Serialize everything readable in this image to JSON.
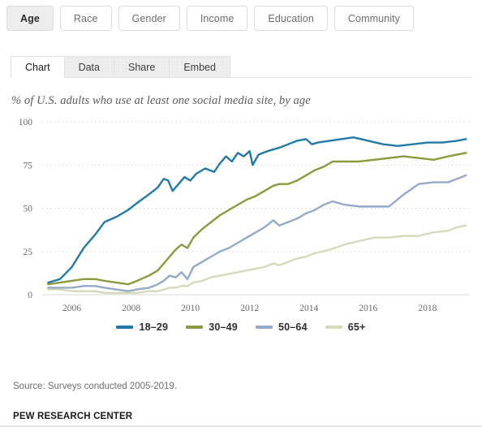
{
  "filters": {
    "items": [
      {
        "label": "Age",
        "active": true
      },
      {
        "label": "Race",
        "active": false
      },
      {
        "label": "Gender",
        "active": false
      },
      {
        "label": "Income",
        "active": false
      },
      {
        "label": "Education",
        "active": false
      },
      {
        "label": "Community",
        "active": false
      }
    ]
  },
  "tabs": {
    "items": [
      {
        "label": "Chart",
        "active": true
      },
      {
        "label": "Data",
        "active": false
      },
      {
        "label": "Share",
        "active": false
      },
      {
        "label": "Embed",
        "active": false
      }
    ]
  },
  "footer": {
    "source": "Source: Surveys conducted 2005-2019.",
    "organization": "PEW RESEARCH CENTER"
  },
  "chart_data": {
    "type": "line",
    "title": "% of U.S. adults who use at least one social media site, by age",
    "xlabel": "",
    "ylabel": "",
    "ylim": [
      0,
      100
    ],
    "xlim": [
      2005.0,
      2019.4
    ],
    "yticks": [
      0,
      25,
      50,
      75,
      100
    ],
    "xticks": [
      2006,
      2008,
      2010,
      2012,
      2014,
      2016,
      2018
    ],
    "grid": "horizontal-dotted",
    "legend_position": "bottom-center",
    "colors": {
      "18-29": "#1f7aa8",
      "30-49": "#8a9a3c",
      "50-64": "#95a9c9",
      "65+": "#d7d8bc"
    },
    "series": [
      {
        "name": "18-29",
        "color": "#1f7aa8",
        "points": [
          [
            2005.2,
            7
          ],
          [
            2005.6,
            9
          ],
          [
            2006.0,
            16
          ],
          [
            2006.4,
            27
          ],
          [
            2006.8,
            35
          ],
          [
            2007.1,
            42
          ],
          [
            2007.5,
            45
          ],
          [
            2007.9,
            49
          ],
          [
            2008.2,
            53
          ],
          [
            2008.6,
            58
          ],
          [
            2008.9,
            62
          ],
          [
            2009.1,
            67
          ],
          [
            2009.25,
            66
          ],
          [
            2009.4,
            60
          ],
          [
            2009.6,
            64
          ],
          [
            2009.8,
            68
          ],
          [
            2010.0,
            66
          ],
          [
            2010.2,
            70
          ],
          [
            2010.5,
            73
          ],
          [
            2010.8,
            71
          ],
          [
            2011.0,
            76
          ],
          [
            2011.2,
            80
          ],
          [
            2011.4,
            77
          ],
          [
            2011.6,
            82
          ],
          [
            2011.8,
            80
          ],
          [
            2012.0,
            83
          ],
          [
            2012.1,
            75
          ],
          [
            2012.3,
            81
          ],
          [
            2012.6,
            83
          ],
          [
            2013.0,
            85
          ],
          [
            2013.3,
            87
          ],
          [
            2013.6,
            89
          ],
          [
            2013.9,
            90
          ],
          [
            2014.1,
            87
          ],
          [
            2014.3,
            88
          ],
          [
            2014.7,
            89
          ],
          [
            2015.1,
            90
          ],
          [
            2015.5,
            91
          ],
          [
            2016.0,
            89
          ],
          [
            2016.5,
            87
          ],
          [
            2017.0,
            86
          ],
          [
            2017.5,
            87
          ],
          [
            2018.0,
            88
          ],
          [
            2018.5,
            88
          ],
          [
            2019.0,
            89
          ],
          [
            2019.3,
            90
          ]
        ]
      },
      {
        "name": "30-49",
        "color": "#8a9a3c",
        "points": [
          [
            2005.2,
            6
          ],
          [
            2005.6,
            7
          ],
          [
            2006.0,
            8
          ],
          [
            2006.4,
            9
          ],
          [
            2006.8,
            9
          ],
          [
            2007.1,
            8
          ],
          [
            2007.5,
            7
          ],
          [
            2007.9,
            6
          ],
          [
            2008.2,
            8
          ],
          [
            2008.6,
            11
          ],
          [
            2008.9,
            14
          ],
          [
            2009.1,
            18
          ],
          [
            2009.3,
            22
          ],
          [
            2009.5,
            26
          ],
          [
            2009.7,
            29
          ],
          [
            2009.9,
            27
          ],
          [
            2010.1,
            33
          ],
          [
            2010.4,
            38
          ],
          [
            2010.7,
            42
          ],
          [
            2011.0,
            46
          ],
          [
            2011.3,
            49
          ],
          [
            2011.6,
            52
          ],
          [
            2011.9,
            55
          ],
          [
            2012.2,
            57
          ],
          [
            2012.5,
            60
          ],
          [
            2012.8,
            63
          ],
          [
            2013.0,
            64
          ],
          [
            2013.3,
            64
          ],
          [
            2013.6,
            66
          ],
          [
            2013.9,
            69
          ],
          [
            2014.2,
            72
          ],
          [
            2014.5,
            74
          ],
          [
            2014.8,
            77
          ],
          [
            2015.2,
            77
          ],
          [
            2015.7,
            77
          ],
          [
            2016.2,
            78
          ],
          [
            2016.7,
            79
          ],
          [
            2017.2,
            80
          ],
          [
            2017.7,
            79
          ],
          [
            2018.2,
            78
          ],
          [
            2018.7,
            80
          ],
          [
            2019.0,
            81
          ],
          [
            2019.3,
            82
          ]
        ]
      },
      {
        "name": "50-64",
        "color": "#95a9c9",
        "points": [
          [
            2005.2,
            4
          ],
          [
            2005.6,
            4
          ],
          [
            2006.0,
            4
          ],
          [
            2006.4,
            5
          ],
          [
            2006.8,
            5
          ],
          [
            2007.1,
            4
          ],
          [
            2007.5,
            3
          ],
          [
            2007.9,
            2
          ],
          [
            2008.2,
            3
          ],
          [
            2008.6,
            4
          ],
          [
            2008.9,
            6
          ],
          [
            2009.1,
            8
          ],
          [
            2009.3,
            11
          ],
          [
            2009.5,
            10
          ],
          [
            2009.7,
            13
          ],
          [
            2009.9,
            9
          ],
          [
            2010.1,
            16
          ],
          [
            2010.4,
            19
          ],
          [
            2010.7,
            22
          ],
          [
            2011.0,
            25
          ],
          [
            2011.3,
            27
          ],
          [
            2011.6,
            30
          ],
          [
            2011.9,
            33
          ],
          [
            2012.2,
            36
          ],
          [
            2012.5,
            39
          ],
          [
            2012.8,
            43
          ],
          [
            2013.0,
            40
          ],
          [
            2013.3,
            42
          ],
          [
            2013.6,
            44
          ],
          [
            2013.9,
            47
          ],
          [
            2014.2,
            49
          ],
          [
            2014.5,
            52
          ],
          [
            2014.8,
            54
          ],
          [
            2015.2,
            52
          ],
          [
            2015.7,
            51
          ],
          [
            2016.2,
            51
          ],
          [
            2016.7,
            51
          ],
          [
            2017.2,
            58
          ],
          [
            2017.7,
            64
          ],
          [
            2018.2,
            65
          ],
          [
            2018.7,
            65
          ],
          [
            2019.0,
            67
          ],
          [
            2019.3,
            69
          ]
        ]
      },
      {
        "name": "65+",
        "color": "#d7d8bc",
        "points": [
          [
            2005.2,
            3
          ],
          [
            2005.6,
            3
          ],
          [
            2006.0,
            2
          ],
          [
            2006.4,
            2
          ],
          [
            2006.8,
            2
          ],
          [
            2007.1,
            1
          ],
          [
            2007.5,
            1
          ],
          [
            2007.9,
            1
          ],
          [
            2008.2,
            1
          ],
          [
            2008.6,
            2
          ],
          [
            2008.9,
            2
          ],
          [
            2009.1,
            3
          ],
          [
            2009.3,
            4
          ],
          [
            2009.5,
            4
          ],
          [
            2009.7,
            5
          ],
          [
            2009.9,
            5
          ],
          [
            2010.1,
            7
          ],
          [
            2010.4,
            8
          ],
          [
            2010.7,
            10
          ],
          [
            2011.0,
            11
          ],
          [
            2011.3,
            12
          ],
          [
            2011.6,
            13
          ],
          [
            2011.9,
            14
          ],
          [
            2012.2,
            15
          ],
          [
            2012.5,
            16
          ],
          [
            2012.8,
            18
          ],
          [
            2013.0,
            17
          ],
          [
            2013.3,
            19
          ],
          [
            2013.6,
            21
          ],
          [
            2013.9,
            22
          ],
          [
            2014.2,
            24
          ],
          [
            2014.7,
            26
          ],
          [
            2015.2,
            29
          ],
          [
            2015.7,
            31
          ],
          [
            2016.2,
            33
          ],
          [
            2016.7,
            33
          ],
          [
            2017.2,
            34
          ],
          [
            2017.7,
            34
          ],
          [
            2018.2,
            36
          ],
          [
            2018.7,
            37
          ],
          [
            2019.0,
            39
          ],
          [
            2019.3,
            40
          ]
        ]
      }
    ]
  }
}
